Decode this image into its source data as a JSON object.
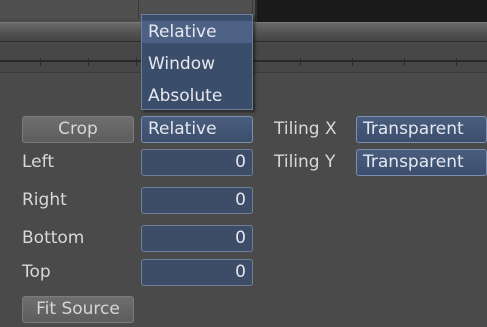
{
  "dropdown": {
    "options": [
      "Relative",
      "Window",
      "Absolute"
    ],
    "highlighted": "Relative"
  },
  "crop": {
    "button_label": "Crop",
    "mode_value": "Relative",
    "fields": [
      {
        "label": "Left",
        "value": "0"
      },
      {
        "label": "Right",
        "value": "0"
      },
      {
        "label": "Bottom",
        "value": "0"
      },
      {
        "label": "Top",
        "value": "0"
      }
    ],
    "fit_source_label": "Fit Source"
  },
  "tiling": {
    "x_label": "Tiling X",
    "x_value": "Transparent",
    "y_label": "Tiling Y",
    "y_value": "Transparent"
  }
}
